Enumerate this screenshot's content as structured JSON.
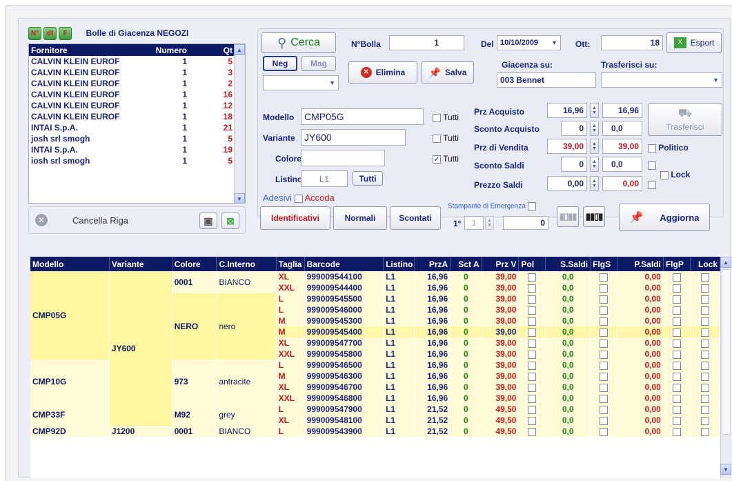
{
  "toolbar": {
    "n_label": "N°",
    "dt_label": "dt",
    "f_label": "F",
    "title": "Bolle di Giacenza NEGOZI"
  },
  "suppliers": {
    "headers": [
      "Fornitore",
      "Numero",
      "Qt"
    ],
    "rows": [
      [
        "CALVIN KLEIN EUROF",
        "1",
        "5"
      ],
      [
        "CALVIN KLEIN EUROF",
        "1",
        "3"
      ],
      [
        "CALVIN KLEIN EUROF",
        "1",
        "2"
      ],
      [
        "CALVIN KLEIN EUROF",
        "1",
        "16"
      ],
      [
        "CALVIN KLEIN EUROF",
        "1",
        "12"
      ],
      [
        "CALVIN KLEIN EUROF",
        "1",
        "18"
      ],
      [
        "INTAI S.p.A.",
        "1",
        "21"
      ],
      [
        "josh srl smogh",
        "1",
        "5"
      ],
      [
        "INTAI S.p.A.",
        "1",
        "19"
      ],
      [
        "iosh srl smogh",
        "1",
        "5"
      ]
    ]
  },
  "cancella_label": "Cancella Riga",
  "search": {
    "label": "Cerca",
    "neg": "Neg",
    "mag": "Mag"
  },
  "bolla": {
    "nbolla_label": "N°Bolla",
    "nbolla_value": "1",
    "del_label": "Del",
    "date": "10/10/2009",
    "ott_label": "Ott:",
    "ott_value": "18",
    "esport_label": "Esport"
  },
  "actions": {
    "elimina": "Elimina",
    "salva": "Salva"
  },
  "giacenza": {
    "label": "Giacenza su:",
    "value": "003  Bennet"
  },
  "trasferisci": {
    "label": "Trasferisci su:",
    "button": "Trasferisci"
  },
  "filters": {
    "modello_label": "Modello",
    "modello_value": "CMP05G",
    "variante_label": "Variante",
    "variante_value": "JY600",
    "colore_label": "Colore",
    "colore_value": "",
    "listino_label": "Listino",
    "listino_value": "L1",
    "tutti_button": "Tutti",
    "tutti": "Tutti"
  },
  "prices": {
    "acquisto_label": "Prz Acquisto",
    "acquisto_value": "16,96",
    "acquisto_value2": "16,96",
    "sconto_acq_label": "Sconto Acquisto",
    "sconto_acq_value": "0",
    "sconto_acq_value2": "0,0",
    "vendita_label": "Prz di Vendita",
    "vendita_value": "39,00",
    "vendita_value2": "39,00",
    "sconto_saldi_label": "Sconto Saldi",
    "sconto_saldi_value": "0",
    "sconto_saldi_value2": "0,0",
    "prezzo_saldi_label": "Prezzo Saldi",
    "prezzo_saldi_value": "0,00",
    "prezzo_saldi_value2": "0,00",
    "politico_label": "Politico",
    "lock_label": "Lock"
  },
  "adesivi": {
    "label": "Adesivi",
    "accoda": "Accoda",
    "identificativi": "Identificativi",
    "normali": "Normali",
    "scontati": "Scontati"
  },
  "stampante": {
    "label": "Stampante di Emergenza",
    "first": "1°",
    "spin_val": "1",
    "count": "0"
  },
  "aggiorna": "Aggiorna",
  "grid": {
    "headers": [
      "Modello",
      "Variante",
      "Colore",
      "C.Interno",
      "Taglia",
      "Barcode",
      "Listino",
      "PrzA",
      "Sct A",
      "Prz V",
      "Pol",
      "S.Saldi",
      "FlgS",
      "P.Saldi",
      "FlgP",
      "Lock"
    ],
    "groups": {
      "m1": "CMP05G",
      "m2": "CMP10G",
      "m3": "CMP33F",
      "m4": "CMP92D",
      "v1": "JY600",
      "v2": "J1200",
      "c1": "0001",
      "ci1": "BIANCO",
      "c2": "NERO",
      "ci2": "nero",
      "c3": "973",
      "ci3": "antracite",
      "c4": "M92",
      "ci4": "grey",
      "c5": "0001",
      "ci5": "BIANCO"
    },
    "rows": [
      [
        "XL",
        "999009544100",
        "L1",
        "16,96",
        "0",
        "39,00",
        "0,0",
        "0,00"
      ],
      [
        "XXL",
        "999009544400",
        "L1",
        "16,96",
        "0",
        "39,00",
        "0,0",
        "0,00"
      ],
      [
        "L",
        "999009545500",
        "L1",
        "16,96",
        "0",
        "39,00",
        "0,0",
        "0,00"
      ],
      [
        "L",
        "999009546000",
        "L1",
        "16,96",
        "0",
        "39,00",
        "0,0",
        "0,00"
      ],
      [
        "M",
        "999009545300",
        "L1",
        "16,96",
        "0",
        "39,00",
        "0,0",
        "0,00"
      ],
      [
        "M",
        "999009545400",
        "L1",
        "16,96",
        "0",
        "39,00",
        "0,0",
        "0,00"
      ],
      [
        "XL",
        "999009547700",
        "L1",
        "16,96",
        "0",
        "39,00",
        "0,0",
        "0,00"
      ],
      [
        "XXL",
        "999009545800",
        "L1",
        "16,96",
        "0",
        "39,00",
        "0,0",
        "0,00"
      ],
      [
        "L",
        "999009546500",
        "L1",
        "16,96",
        "0",
        "39,00",
        "0,0",
        "0,00"
      ],
      [
        "M",
        "999009546300",
        "L1",
        "16,96",
        "0",
        "39,00",
        "0,0",
        "0,00"
      ],
      [
        "XL",
        "999009546700",
        "L1",
        "16,96",
        "0",
        "39,00",
        "0,0",
        "0,00"
      ],
      [
        "XXL",
        "999009546800",
        "L1",
        "16,96",
        "0",
        "39,00",
        "0,0",
        "0,00"
      ],
      [
        "L",
        "999009547900",
        "L1",
        "21,52",
        "0",
        "49,50",
        "0,0",
        "0,00"
      ],
      [
        "XL",
        "999009548100",
        "L1",
        "21,52",
        "0",
        "49,50",
        "0,0",
        "0,00"
      ],
      [
        "L",
        "999009543900",
        "L1",
        "21,52",
        "0",
        "49,50",
        "0,0",
        "0,00"
      ]
    ]
  }
}
